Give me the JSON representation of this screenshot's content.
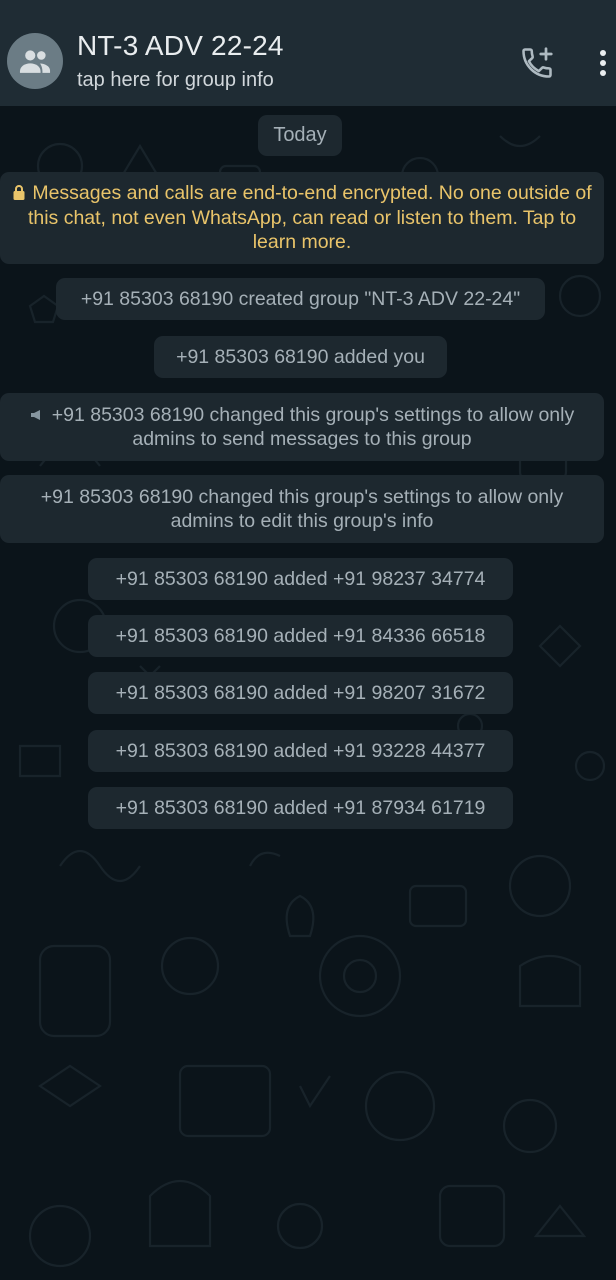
{
  "header": {
    "title": "NT-3 ADV 22-24",
    "subtitle": "tap here for group info",
    "avatar_icon": "group-icon",
    "call_icon": "add-call-icon",
    "menu_icon": "more-vert-icon"
  },
  "chat": {
    "date_label": "Today",
    "encryption_notice": "Messages and calls are end-to-end encrypted. No one outside of this chat, not even WhatsApp, can read or listen to them. Tap to learn more.",
    "system_messages": [
      "+91 85303 68190 created group \"NT-3 ADV 22-24\"",
      "+91 85303 68190 added you",
      "+91 85303 68190 changed this group's settings to allow only admins to send messages to this group",
      "+91 85303 68190 changed this group's settings to allow only admins to edit this group's info",
      "+91 85303 68190 added +91 98237 34774",
      "+91 85303 68190 added +91 84336 66518",
      "+91 85303 68190 added +91 98207 31672",
      "+91 85303 68190 added +91 93228 44377",
      "+91 85303 68190 added +91 87934 61719"
    ]
  },
  "colors": {
    "header_bg": "#1f2c34",
    "chat_bg": "#0b141a",
    "bubble_bg": "#1d282f",
    "system_text": "#a5b0b7",
    "encryption_text": "#e9c46a",
    "title_text": "#e9edef"
  }
}
